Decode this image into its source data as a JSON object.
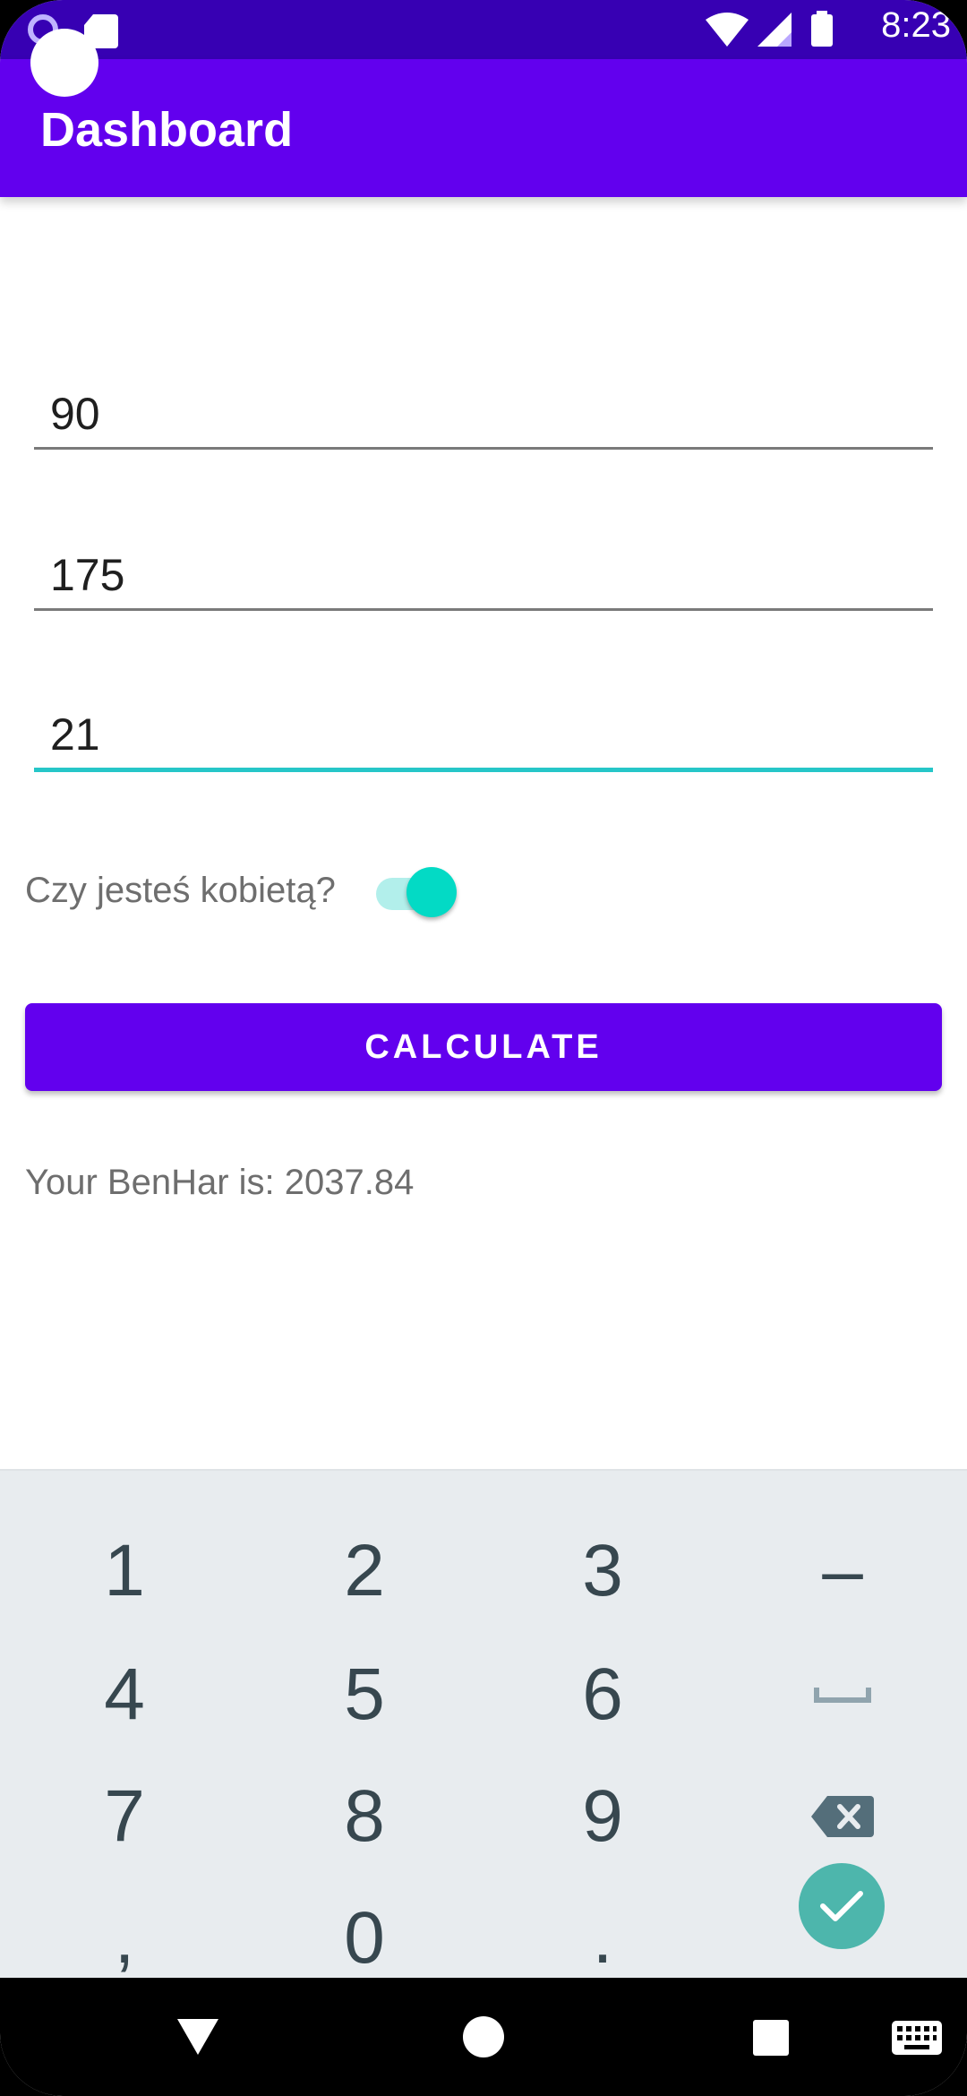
{
  "status_bar": {
    "time": "8:23",
    "icons": [
      "circle-notification-icon",
      "sd-card-icon",
      "wifi-icon",
      "signal-icon",
      "battery-icon"
    ]
  },
  "app_bar": {
    "title": "Dashboard"
  },
  "form": {
    "weight_value": "90",
    "height_value": "175",
    "age_value": "21",
    "switch_label": "Czy jesteś kobietą?",
    "switch_on": true,
    "calculate_label": "CALCULATE",
    "result_text": "Your BenHar is: 2037.84"
  },
  "keyboard": {
    "rows": [
      [
        "1",
        "2",
        "3",
        "–"
      ],
      [
        "4",
        "5",
        "6",
        "space"
      ],
      [
        "7",
        "8",
        "9",
        "backspace"
      ],
      [
        ",",
        "0",
        ".",
        "done"
      ]
    ],
    "keys": {
      "k1": "1",
      "k2": "2",
      "k3": "3",
      "k_minus": "–",
      "k4": "4",
      "k5": "5",
      "k6": "6",
      "k7": "7",
      "k8": "8",
      "k9": "9",
      "k_comma": ",",
      "k0": "0",
      "k_dot": "."
    }
  },
  "colors": {
    "status_bar": "#3700b3",
    "primary": "#6200ee",
    "accent": "#03dac5",
    "keyboard_bg": "#e8ecef",
    "keyboard_done": "#4db6ac"
  },
  "nav_bar": {
    "icons": [
      "back-icon",
      "home-icon",
      "recents-icon",
      "keyboard-switch-icon"
    ]
  }
}
